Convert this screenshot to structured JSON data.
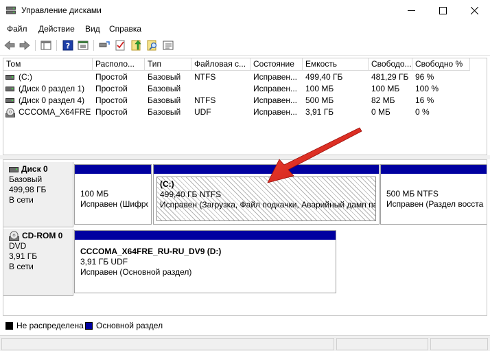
{
  "window": {
    "title": "Управление дисками",
    "icons": {
      "app": "disk-management-icon",
      "minimize": "minimize-icon",
      "maximize": "maximize-icon",
      "close": "close-icon"
    }
  },
  "menu": {
    "file": "Файл",
    "action": "Действие",
    "view": "Вид",
    "help": "Справка"
  },
  "toolbar": {
    "icons": [
      "back-arrow-icon",
      "forward-arrow-icon",
      "console-tree-icon",
      "help-icon",
      "properties-icon",
      "connect-icon",
      "check-icon",
      "up-arrow-icon",
      "search-icon",
      "list-view-icon"
    ]
  },
  "volume_list": {
    "columns": [
      "Том",
      "Располо...",
      "Тип",
      "Файловая с...",
      "Состояние",
      "Емкость",
      "Свободо...",
      "Свободно %"
    ],
    "rows": [
      {
        "icon": "drive-icon",
        "volume": "(C:)",
        "layout": "Простой",
        "type": "Базовый",
        "fs": "NTFS",
        "status": "Исправен...",
        "capacity": "499,40 ГБ",
        "free": "481,29 ГБ",
        "free_pct": "96 %"
      },
      {
        "icon": "drive-icon",
        "volume": "(Диск 0 раздел 1)",
        "layout": "Простой",
        "type": "Базовый",
        "fs": "",
        "status": "Исправен...",
        "capacity": "100 МБ",
        "free": "100 МБ",
        "free_pct": "100 %"
      },
      {
        "icon": "drive-icon",
        "volume": "(Диск 0 раздел 4)",
        "layout": "Простой",
        "type": "Базовый",
        "fs": "NTFS",
        "status": "Исправен...",
        "capacity": "500 МБ",
        "free": "82 МБ",
        "free_pct": "16 %"
      },
      {
        "icon": "cd-icon",
        "volume": "CCCOMA_X64FRE...",
        "layout": "Простой",
        "type": "Базовый",
        "fs": "UDF",
        "status": "Исправен...",
        "capacity": "3,91 ГБ",
        "free": "0 МБ",
        "free_pct": "0 %"
      }
    ]
  },
  "disks": [
    {
      "name": "Диск 0",
      "icon": "hard-disk-icon",
      "type": "Базовый",
      "size": "499,98 ГБ",
      "status": "В сети",
      "partitions": [
        {
          "title": "",
          "size": "100 МБ",
          "status": "Исправен (Шифро"
        },
        {
          "title": "(C:)",
          "size": "499,40 ГБ NTFS",
          "status": "Исправен (Загрузка, Файл подкачки, Аварийный дамп па"
        },
        {
          "title": "",
          "size": "500 МБ NTFS",
          "status": "Исправен (Раздел восстан"
        }
      ]
    },
    {
      "name": "CD-ROM 0",
      "icon": "cdrom-icon",
      "type": "DVD",
      "size": "3,91 ГБ",
      "status": "В сети",
      "partitions": [
        {
          "title": "CCCOMA_X64FRE_RU-RU_DV9  (D:)",
          "size": "3,91 ГБ UDF",
          "status": "Исправен (Основной раздел)"
        }
      ]
    }
  ],
  "legend": {
    "unallocated": "Не распределена",
    "primary": "Основной раздел",
    "colors": {
      "unallocated": "#000000",
      "primary": "#0000a0"
    }
  },
  "annotation": {
    "icon": "red-arrow-icon",
    "color": "#e0201c"
  }
}
